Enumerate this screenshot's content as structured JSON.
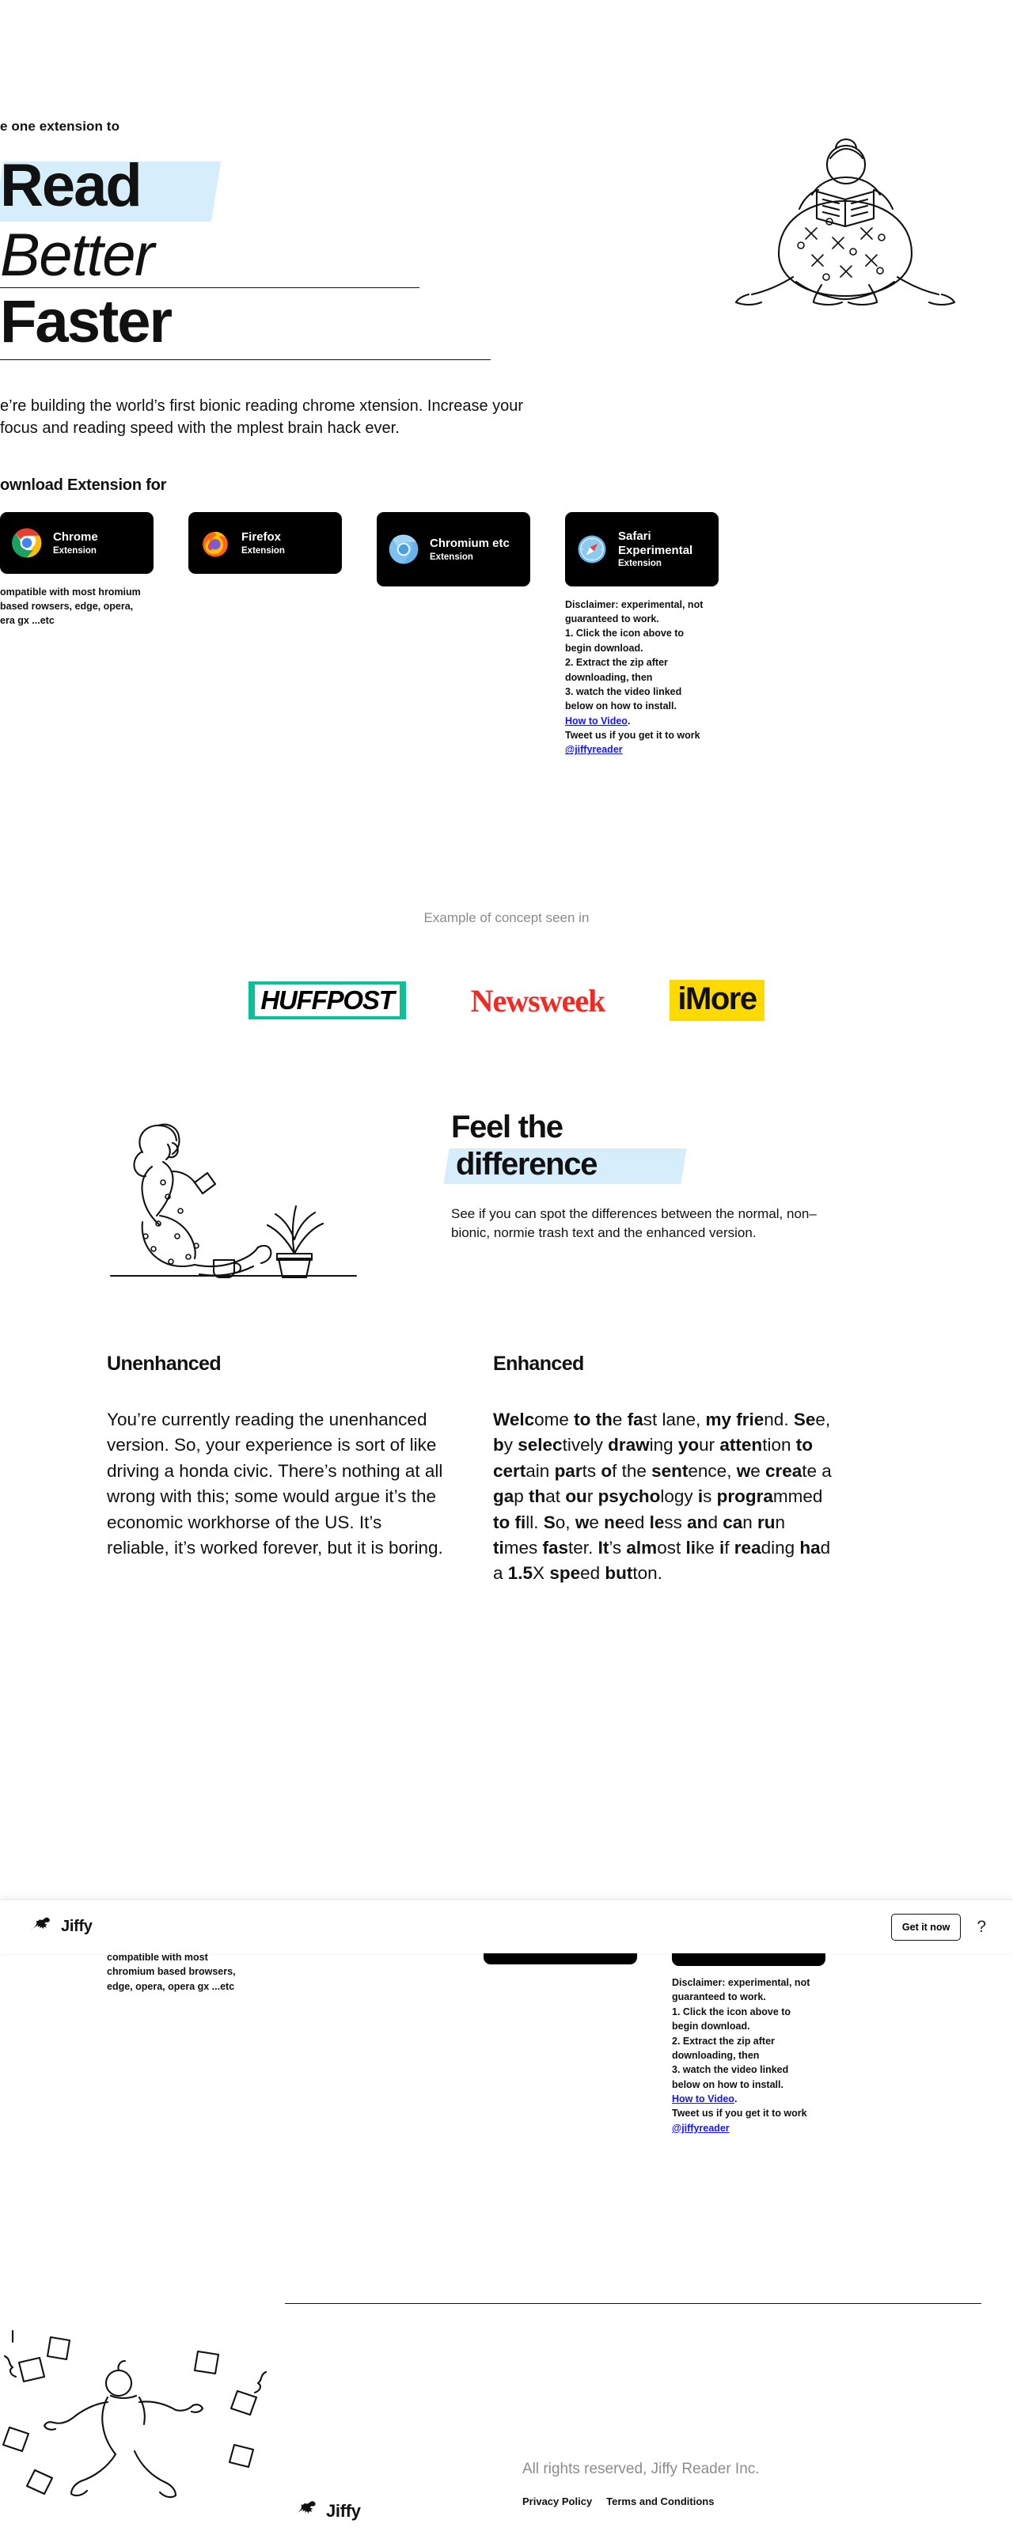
{
  "hero": {
    "eyebrow": "e one extension to",
    "headline": {
      "line1": "Read",
      "line2": "Better",
      "line3": "Faster"
    },
    "subtitle": "e’re building the world’s first bionic reading chrome xtension. Increase your focus and reading speed with the mplest brain hack ever.",
    "download_title": "ownload Extension for"
  },
  "downloads": [
    {
      "icon": "chrome-icon",
      "name": "Chrome",
      "kind": "Extension",
      "note": "ompatible with most hromium based rowsers, edge, opera, era gx ...etc"
    },
    {
      "icon": "firefox-icon",
      "name": "Firefox",
      "kind": "Extension",
      "note": ""
    },
    {
      "icon": "chromium-icon",
      "name": "Chromium etc",
      "kind": "Extension",
      "note": ""
    },
    {
      "icon": "safari-icon",
      "name": "Safari Experimental",
      "kind": "Extension",
      "note": "Disclaimer: experimental, not guaranteed to work.\n1. Click the icon above to begin download.\n2. Extract the zip after downloading, then\n3. watch the video linked below on how to install. ",
      "note_link": "How to Video",
      "note_tail": ".\nTweet us if you get it to work ",
      "note_handle": "@jiffyreader"
    }
  ],
  "seen_in": {
    "label": "Example of concept seen in",
    "logos": [
      "HUFFPOST",
      "Newsweek",
      "iMore"
    ]
  },
  "feel": {
    "title_line1": "Feel the",
    "title_line2": "difference",
    "paragraph": "See if you can spot the differences between the normal, non–bionic, normie trash text and the enhanced version."
  },
  "compare": {
    "unenhanced": {
      "heading": "Unenhanced",
      "body": "You’re currently reading the unenhanced version. So, your experience is sort of like driving a honda civic. There’s nothing at all wrong with this; some would argue it’s the economic workhorse of the US. It’s reliable, it’s worked forever, but it is boring."
    },
    "enhanced": {
      "heading": "Enhanced",
      "tokens": [
        [
          "Welc",
          "ome"
        ],
        [
          "to",
          ""
        ],
        [
          "th",
          "e"
        ],
        [
          "fa",
          "st"
        ],
        [
          "",
          "lane,"
        ],
        [
          "my",
          ""
        ],
        [
          "frie",
          "nd."
        ],
        [
          "Se",
          "e,"
        ],
        [
          "b",
          "y"
        ],
        [
          "selec",
          "tively"
        ],
        [
          "draw",
          "ing"
        ],
        [
          "yo",
          "ur"
        ],
        [
          "atten",
          "tion"
        ],
        [
          "to",
          ""
        ],
        [
          "cert",
          "ain"
        ],
        [
          "par",
          "ts"
        ],
        [
          "o",
          "f"
        ],
        [
          "",
          "the"
        ],
        [
          "sent",
          "ence,"
        ],
        [
          "w",
          "e"
        ],
        [
          "crea",
          "te"
        ],
        [
          "",
          "a"
        ],
        [
          "ga",
          "p"
        ],
        [
          "th",
          "at"
        ],
        [
          "ou",
          "r"
        ],
        [
          "psycho",
          "logy"
        ],
        [
          "i",
          "s"
        ],
        [
          "progra",
          "mmed"
        ],
        [
          "to",
          ""
        ],
        [
          "fi",
          "ll."
        ],
        [
          "S",
          "o,"
        ],
        [
          "w",
          "e"
        ],
        [
          "ne",
          "ed"
        ],
        [
          "le",
          "ss"
        ],
        [
          "an",
          "d"
        ],
        [
          "ca",
          "n"
        ],
        [
          "ru",
          "n"
        ],
        [
          "ti",
          "mes"
        ],
        [
          "fas",
          "ter."
        ],
        [
          "It",
          "’s"
        ],
        [
          "alm",
          "ost"
        ],
        [
          "li",
          "ke"
        ],
        [
          "i",
          "f"
        ],
        [
          "rea",
          "ding"
        ],
        [
          "ha",
          "d"
        ],
        [
          "",
          "a"
        ],
        [
          "1.5",
          "X"
        ],
        [
          "spe",
          "ed"
        ],
        [
          "but",
          "ton."
        ]
      ]
    }
  },
  "sticky_bar": {
    "brand": "Jiffy",
    "cta_label": "Get it now",
    "help_label": "?"
  },
  "bottom_notes": {
    "chrome": "compatible with most chromium based browsers, edge, opera, opera gx ...etc",
    "safari_head": "Disclaimer: experimental, not guaranteed to work.",
    "safari_1": "1. Click the icon above to begin download.",
    "safari_2": "2. Extract the zip after downloading, then",
    "safari_3": "3. watch the video linked below on how to install.",
    "safari_link": "How to Video",
    "safari_tweet": "Tweet us if you get it to work ",
    "safari_handle": "@jiffyreader"
  },
  "footer": {
    "brand": "Jiffy",
    "rights": "All rights reserved, Jiffy Reader Inc.",
    "links": [
      "Privacy Policy",
      "Terms and Conditions"
    ]
  },
  "colors": {
    "highlight": "#d6eefb",
    "link": "#1414ff",
    "huffpost": "#0dbe98",
    "newsweek": "#ef2b24",
    "imore": "#ffd900",
    "muted": "#8c8c8c"
  }
}
